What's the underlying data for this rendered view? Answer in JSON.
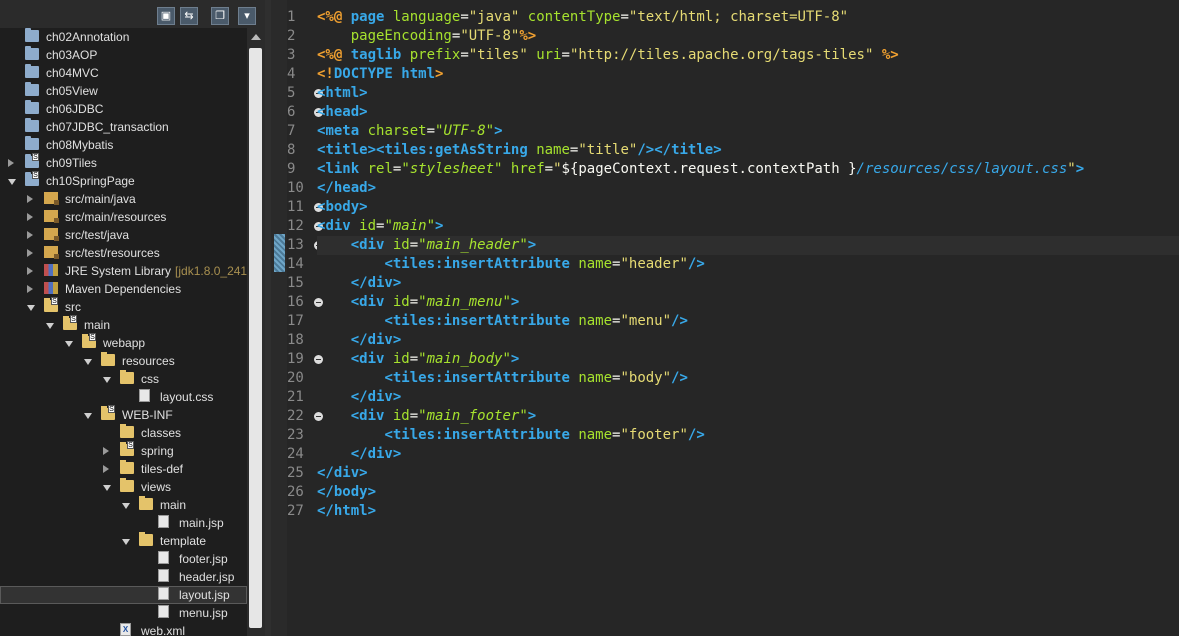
{
  "toolbar": {
    "buttons": [
      {
        "name": "collapse-all-icon",
        "glyph": "▣"
      },
      {
        "name": "link-with-editor-icon",
        "glyph": "⇆"
      },
      {
        "name": "focus-on-active-task-icon",
        "glyph": "❐"
      },
      {
        "name": "view-menu-icon",
        "glyph": "▾"
      }
    ]
  },
  "tree": [
    {
      "label": "ch02Annotation",
      "depth": 0,
      "twisty": "none",
      "icon": "prj"
    },
    {
      "label": "ch03AOP",
      "depth": 0,
      "twisty": "none",
      "icon": "prj"
    },
    {
      "label": "ch04MVC",
      "depth": 0,
      "twisty": "none",
      "icon": "prj"
    },
    {
      "label": "ch05View",
      "depth": 0,
      "twisty": "none",
      "icon": "prj"
    },
    {
      "label": "ch06JDBC",
      "depth": 0,
      "twisty": "none",
      "icon": "prj"
    },
    {
      "label": "ch07JDBC_transaction",
      "depth": 0,
      "twisty": "none",
      "icon": "prj"
    },
    {
      "label": "ch08Mybatis",
      "depth": 0,
      "twisty": "none",
      "icon": "prj"
    },
    {
      "label": "ch09Tiles",
      "depth": 0,
      "twisty": "c",
      "icon": "prj",
      "overlay": "S"
    },
    {
      "label": "ch10SpringPage",
      "depth": 0,
      "twisty": "e",
      "icon": "prj",
      "overlay": "S"
    },
    {
      "label": "src/main/java",
      "depth": 1,
      "twisty": "c",
      "icon": "srcf"
    },
    {
      "label": "src/main/resources",
      "depth": 1,
      "twisty": "c",
      "icon": "srcf"
    },
    {
      "label": "src/test/java",
      "depth": 1,
      "twisty": "c",
      "icon": "srcf"
    },
    {
      "label": "src/test/resources",
      "depth": 1,
      "twisty": "c",
      "icon": "srcf"
    },
    {
      "label": "JRE System Library",
      "decoration": "[jdk1.8.0_241]",
      "depth": 1,
      "twisty": "c",
      "icon": "lib"
    },
    {
      "label": "Maven Dependencies",
      "depth": 1,
      "twisty": "c",
      "icon": "lib"
    },
    {
      "label": "src",
      "depth": 1,
      "twisty": "e",
      "icon": "fold",
      "overlay": "S"
    },
    {
      "label": "main",
      "depth": 2,
      "twisty": "e",
      "icon": "fold",
      "overlay": "S"
    },
    {
      "label": "webapp",
      "depth": 3,
      "twisty": "e",
      "icon": "fold",
      "overlay": "S"
    },
    {
      "label": "resources",
      "depth": 4,
      "twisty": "e",
      "icon": "fold"
    },
    {
      "label": "css",
      "depth": 5,
      "twisty": "e",
      "icon": "fold"
    },
    {
      "label": "layout.css",
      "depth": 6,
      "twisty": "none",
      "icon": "file"
    },
    {
      "label": "WEB-INF",
      "depth": 4,
      "twisty": "e",
      "icon": "fold",
      "overlay": "S"
    },
    {
      "label": "classes",
      "depth": 5,
      "twisty": "none",
      "icon": "fold"
    },
    {
      "label": "spring",
      "depth": 5,
      "twisty": "c",
      "icon": "fold",
      "overlay": "S"
    },
    {
      "label": "tiles-def",
      "depth": 5,
      "twisty": "c",
      "icon": "fold"
    },
    {
      "label": "views",
      "depth": 5,
      "twisty": "e",
      "icon": "fold"
    },
    {
      "label": "main",
      "depth": 6,
      "twisty": "e",
      "icon": "fold"
    },
    {
      "label": "main.jsp",
      "depth": 7,
      "twisty": "none",
      "icon": "file"
    },
    {
      "label": "template",
      "depth": 6,
      "twisty": "e",
      "icon": "fold"
    },
    {
      "label": "footer.jsp",
      "depth": 7,
      "twisty": "none",
      "icon": "file"
    },
    {
      "label": "header.jsp",
      "depth": 7,
      "twisty": "none",
      "icon": "file"
    },
    {
      "label": "layout.jsp",
      "depth": 7,
      "twisty": "none",
      "icon": "file",
      "selected": true
    },
    {
      "label": "menu.jsp",
      "depth": 7,
      "twisty": "none",
      "icon": "file"
    },
    {
      "label": "web.xml",
      "depth": 5,
      "twisty": "none",
      "icon": "xml"
    }
  ],
  "colors": {
    "delim": "#f0a030",
    "tag": "#38a8e8",
    "attr": "#a6e22e",
    "string": "#e6db74",
    "italicAttr": "#a6e22e",
    "text": "#f8f8f2",
    "jstl": "#a6e22e",
    "path": "#38a8e8"
  },
  "editor": {
    "current_line": 13,
    "change_lines": [
      13,
      14
    ],
    "fold_lines": [
      5,
      6,
      11,
      12,
      13,
      16,
      19,
      22
    ],
    "lines": [
      [
        [
          "d",
          "<%@ "
        ],
        [
          "k",
          "page "
        ],
        [
          "a",
          "language"
        ],
        [
          "t",
          "="
        ],
        [
          "s",
          "\"java\""
        ],
        [
          "t",
          " "
        ],
        [
          "a",
          "contentType"
        ],
        [
          "t",
          "="
        ],
        [
          "s",
          "\"text/html; charset=UTF-8\""
        ]
      ],
      [
        [
          "t",
          "    "
        ],
        [
          "a",
          "pageEncoding"
        ],
        [
          "t",
          "="
        ],
        [
          "s",
          "\"UTF-8\""
        ],
        [
          "d",
          "%>"
        ]
      ],
      [
        [
          "d",
          "<%@ "
        ],
        [
          "k",
          "taglib "
        ],
        [
          "a",
          "prefix"
        ],
        [
          "t",
          "="
        ],
        [
          "s",
          "\"tiles\""
        ],
        [
          "t",
          " "
        ],
        [
          "a",
          "uri"
        ],
        [
          "t",
          "="
        ],
        [
          "s",
          "\"http://tiles.apache.org/tags-tiles\""
        ],
        [
          "t",
          " "
        ],
        [
          "d",
          "%>"
        ]
      ],
      [
        [
          "d",
          "<!"
        ],
        [
          "k",
          "DOCTYPE "
        ],
        [
          "g",
          "html"
        ],
        [
          "d",
          ">"
        ]
      ],
      [
        [
          "g",
          "<html>"
        ]
      ],
      [
        [
          "g",
          "<head>"
        ]
      ],
      [
        [
          "g",
          "<"
        ],
        [
          "k",
          "meta "
        ],
        [
          "a",
          "charset"
        ],
        [
          "t",
          "="
        ],
        [
          "i",
          "\"UTF-8\""
        ],
        [
          "g",
          ">"
        ]
      ],
      [
        [
          "g",
          "<"
        ],
        [
          "k",
          "title"
        ],
        [
          "g",
          ">"
        ],
        [
          "g",
          "<"
        ],
        [
          "k",
          "tiles:getAsString "
        ],
        [
          "a",
          "name"
        ],
        [
          "t",
          "="
        ],
        [
          "s",
          "\"title\""
        ],
        [
          "g",
          "/></"
        ],
        [
          "k",
          "title"
        ],
        [
          "g",
          ">"
        ]
      ],
      [
        [
          "g",
          "<"
        ],
        [
          "k",
          "link "
        ],
        [
          "a",
          "rel"
        ],
        [
          "t",
          "="
        ],
        [
          "i",
          "\"stylesheet\""
        ],
        [
          "t",
          " "
        ],
        [
          "a",
          "href"
        ],
        [
          "t",
          "="
        ],
        [
          "s",
          "\""
        ],
        [
          "t",
          "${pageContext.request.contextPath }"
        ],
        [
          "p",
          "/resources/css/layout.css"
        ],
        [
          "s",
          "\""
        ],
        [
          "g",
          ">"
        ]
      ],
      [
        [
          "g",
          "</"
        ],
        [
          "k",
          "head"
        ],
        [
          "g",
          ">"
        ]
      ],
      [
        [
          "g",
          "<"
        ],
        [
          "k",
          "body"
        ],
        [
          "g",
          ">"
        ]
      ],
      [
        [
          "g",
          "<"
        ],
        [
          "k",
          "div "
        ],
        [
          "a",
          "id"
        ],
        [
          "t",
          "="
        ],
        [
          "i",
          "\"main\""
        ],
        [
          "g",
          ">"
        ]
      ],
      [
        [
          "t",
          "    "
        ],
        [
          "g",
          "<"
        ],
        [
          "k",
          "div "
        ],
        [
          "a",
          "id"
        ],
        [
          "t",
          "="
        ],
        [
          "i",
          "\"main_header\""
        ],
        [
          "g",
          ">"
        ]
      ],
      [
        [
          "t",
          "        "
        ],
        [
          "g",
          "<"
        ],
        [
          "k",
          "tiles:insertAttribute "
        ],
        [
          "a",
          "name"
        ],
        [
          "t",
          "="
        ],
        [
          "s",
          "\"header\""
        ],
        [
          "g",
          "/>"
        ]
      ],
      [
        [
          "t",
          "    "
        ],
        [
          "g",
          "</"
        ],
        [
          "k",
          "div"
        ],
        [
          "g",
          ">"
        ]
      ],
      [
        [
          "t",
          "    "
        ],
        [
          "g",
          "<"
        ],
        [
          "k",
          "div "
        ],
        [
          "a",
          "id"
        ],
        [
          "t",
          "="
        ],
        [
          "i",
          "\"main_menu\""
        ],
        [
          "g",
          ">"
        ]
      ],
      [
        [
          "t",
          "        "
        ],
        [
          "g",
          "<"
        ],
        [
          "k",
          "tiles:insertAttribute "
        ],
        [
          "a",
          "name"
        ],
        [
          "t",
          "="
        ],
        [
          "s",
          "\"menu\""
        ],
        [
          "g",
          "/>"
        ]
      ],
      [
        [
          "t",
          "    "
        ],
        [
          "g",
          "</"
        ],
        [
          "k",
          "div"
        ],
        [
          "g",
          ">"
        ]
      ],
      [
        [
          "t",
          "    "
        ],
        [
          "g",
          "<"
        ],
        [
          "k",
          "div "
        ],
        [
          "a",
          "id"
        ],
        [
          "t",
          "="
        ],
        [
          "i",
          "\"main_body\""
        ],
        [
          "g",
          ">"
        ]
      ],
      [
        [
          "t",
          "        "
        ],
        [
          "g",
          "<"
        ],
        [
          "k",
          "tiles:insertAttribute "
        ],
        [
          "a",
          "name"
        ],
        [
          "t",
          "="
        ],
        [
          "s",
          "\"body\""
        ],
        [
          "g",
          "/>"
        ]
      ],
      [
        [
          "t",
          "    "
        ],
        [
          "g",
          "</"
        ],
        [
          "k",
          "div"
        ],
        [
          "g",
          ">"
        ]
      ],
      [
        [
          "t",
          "    "
        ],
        [
          "g",
          "<"
        ],
        [
          "k",
          "div "
        ],
        [
          "a",
          "id"
        ],
        [
          "t",
          "="
        ],
        [
          "i",
          "\"main_footer\""
        ],
        [
          "g",
          ">"
        ]
      ],
      [
        [
          "t",
          "        "
        ],
        [
          "g",
          "<"
        ],
        [
          "k",
          "tiles:insertAttribute "
        ],
        [
          "a",
          "name"
        ],
        [
          "t",
          "="
        ],
        [
          "s",
          "\"footer\""
        ],
        [
          "g",
          "/>"
        ]
      ],
      [
        [
          "t",
          "    "
        ],
        [
          "g",
          "</"
        ],
        [
          "k",
          "div"
        ],
        [
          "g",
          ">"
        ]
      ],
      [
        [
          "g",
          "</"
        ],
        [
          "k",
          "div"
        ],
        [
          "g",
          ">"
        ]
      ],
      [
        [
          "g",
          "</"
        ],
        [
          "k",
          "body"
        ],
        [
          "g",
          ">"
        ]
      ],
      [
        [
          "g",
          "</"
        ],
        [
          "k",
          "html"
        ],
        [
          "g",
          ">"
        ]
      ]
    ]
  }
}
